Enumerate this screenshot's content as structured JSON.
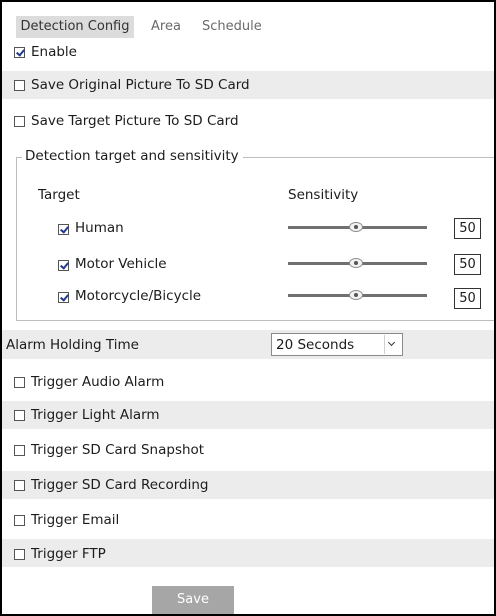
{
  "tabs": [
    {
      "label": "Detection Config",
      "active": true
    },
    {
      "label": "Area",
      "active": false
    },
    {
      "label": "Schedule",
      "active": false
    }
  ],
  "options": {
    "enable": {
      "label": "Enable",
      "checked": true
    },
    "save_original": {
      "label": "Save Original Picture To SD Card",
      "checked": false
    },
    "save_target": {
      "label": "Save Target Picture To SD Card",
      "checked": false
    }
  },
  "detection": {
    "legend": "Detection target and sensitivity",
    "target_header": "Target",
    "sensitivity_header": "Sensitivity",
    "targets": [
      {
        "label": "Human",
        "checked": true,
        "sensitivity": "50",
        "slider_fraction": 0.5
      },
      {
        "label": "Motor Vehicle",
        "checked": true,
        "sensitivity": "50",
        "slider_fraction": 0.5
      },
      {
        "label": "Motorcycle/Bicycle",
        "checked": true,
        "sensitivity": "50",
        "slider_fraction": 0.5
      }
    ]
  },
  "alarm_holding": {
    "label": "Alarm Holding Time",
    "value": "20 Seconds"
  },
  "triggers": [
    {
      "label": "Trigger Audio Alarm",
      "checked": false
    },
    {
      "label": "Trigger Light Alarm",
      "checked": false
    },
    {
      "label": "Trigger SD Card Snapshot",
      "checked": false
    },
    {
      "label": "Trigger SD Card Recording",
      "checked": false
    },
    {
      "label": "Trigger Email",
      "checked": false
    },
    {
      "label": "Trigger FTP",
      "checked": false
    }
  ],
  "save_label": "Save",
  "colors": {
    "row_shade": "#ececec",
    "tab_active_bg": "#dcdcdc",
    "button_bg": "#a6a6a6"
  }
}
